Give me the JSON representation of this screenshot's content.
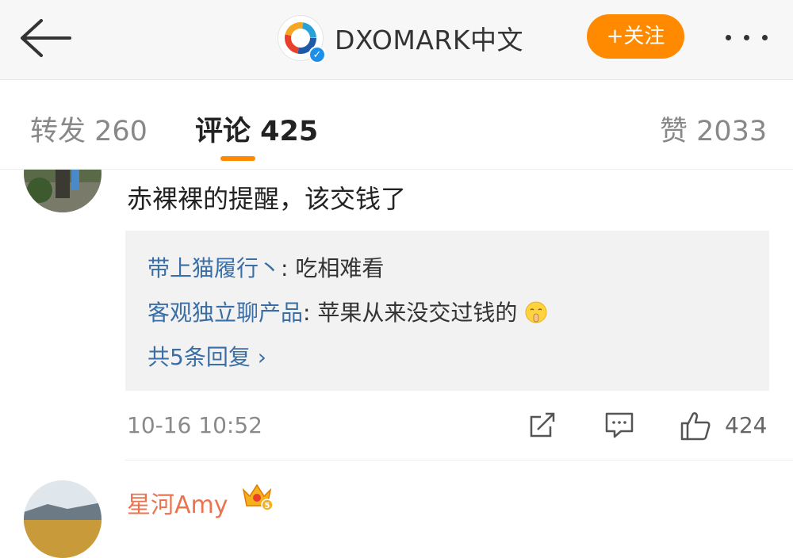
{
  "header": {
    "account_name": "DXOMARK中文",
    "follow_label": "+关注",
    "icons": [
      "back-arrow-icon",
      "verified-icon",
      "more-icon"
    ]
  },
  "tabs": [
    {
      "label": "转发 260"
    },
    {
      "label": "评论 425"
    },
    {
      "label": "赞 2033"
    }
  ],
  "comment": {
    "text": "赤裸裸的提醒，该交钱了",
    "replies": [
      {
        "author": "带上猫履行丶",
        "sep": ": ",
        "text": "吃相难看"
      },
      {
        "author": "客观独立聊产品",
        "sep": ": ",
        "text": "苹果从来没交过钱的"
      }
    ],
    "more_replies": "共5条回复 ›",
    "time": "10-16 10:52",
    "like_count": "424"
  },
  "next_comment": {
    "username": "星河Amy",
    "badge_level": "5"
  },
  "colors": {
    "accent": "#ff8a00",
    "link": "#3a6ea5",
    "username": "#eb7350"
  }
}
